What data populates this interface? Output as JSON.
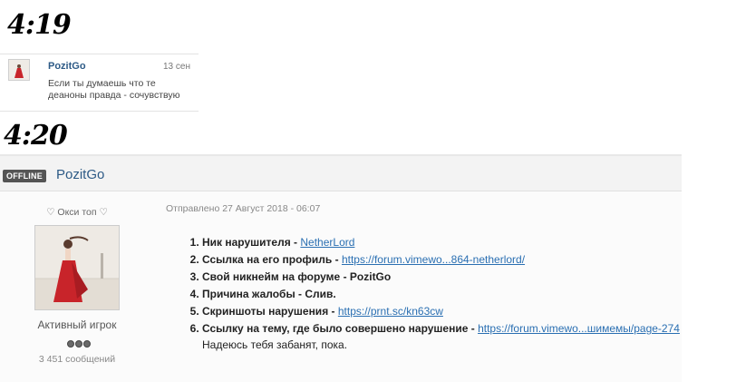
{
  "labels": {
    "time_first": "4:19",
    "time_second": "4:20"
  },
  "snippet": {
    "author": "PozitGo",
    "date": "13 сен",
    "text": "Если ты думаешь что те деаноны правда - сочувствую"
  },
  "post": {
    "status_badge": "OFFLINE",
    "author_name": "PozitGo",
    "author_title": "♡ Окси топ ♡",
    "rank": "Активный игрок",
    "message_count": "3 451 сообщений",
    "sent_line": "Отправлено 27 Август 2018 - 06:07",
    "items": [
      {
        "label": "Ник нарушителя - ",
        "link": "NetherLord"
      },
      {
        "label": "Ссылка на его профиль - ",
        "link": "https://forum.vimewo...864-netherlord/"
      },
      {
        "label": "Свой никнейм на форуме - PozitGo",
        "link": ""
      },
      {
        "label": "Причина жалобы - Слив.",
        "link": ""
      },
      {
        "label": "Скриншоты нарушения - ",
        "link": "https://prnt.sc/kn63cw"
      },
      {
        "label": "Ссылку на тему, где было совершено нарушение - ",
        "link": "https://forum.vimewo...шимемы/page-274"
      }
    ],
    "closing": "Надеюсь тебя забанят, пока."
  },
  "colors": {
    "link": "#2a6fb2",
    "name": "#2d5a86",
    "badge_bg": "#555555",
    "dress": "#c8242a"
  }
}
